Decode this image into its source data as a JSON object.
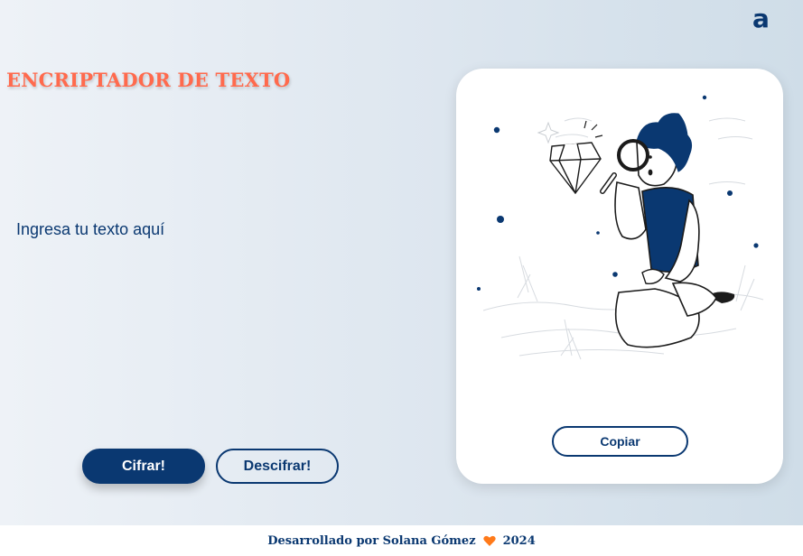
{
  "header": {
    "logo_text": "a",
    "logo_icon": "alura-logo-icon"
  },
  "main": {
    "title": "ENCRIPTADOR DE TEXTO",
    "input_placeholder": "Ingresa tu texto aquí",
    "input_value": "",
    "encrypt_label": "Cifrar!",
    "decrypt_label": "Descifrar!"
  },
  "output_panel": {
    "illustration": "person-with-magnifying-glass-and-diamond",
    "copy_label": "Copiar"
  },
  "footer": {
    "credit": "Desarrollado por Solana Gómez",
    "heart_icon": "heart-icon",
    "year": "2024"
  },
  "colors": {
    "primary": "#0a3871",
    "accent": "#ff6a4d",
    "heart": "#ff7a1a",
    "card": "#ffffff"
  }
}
